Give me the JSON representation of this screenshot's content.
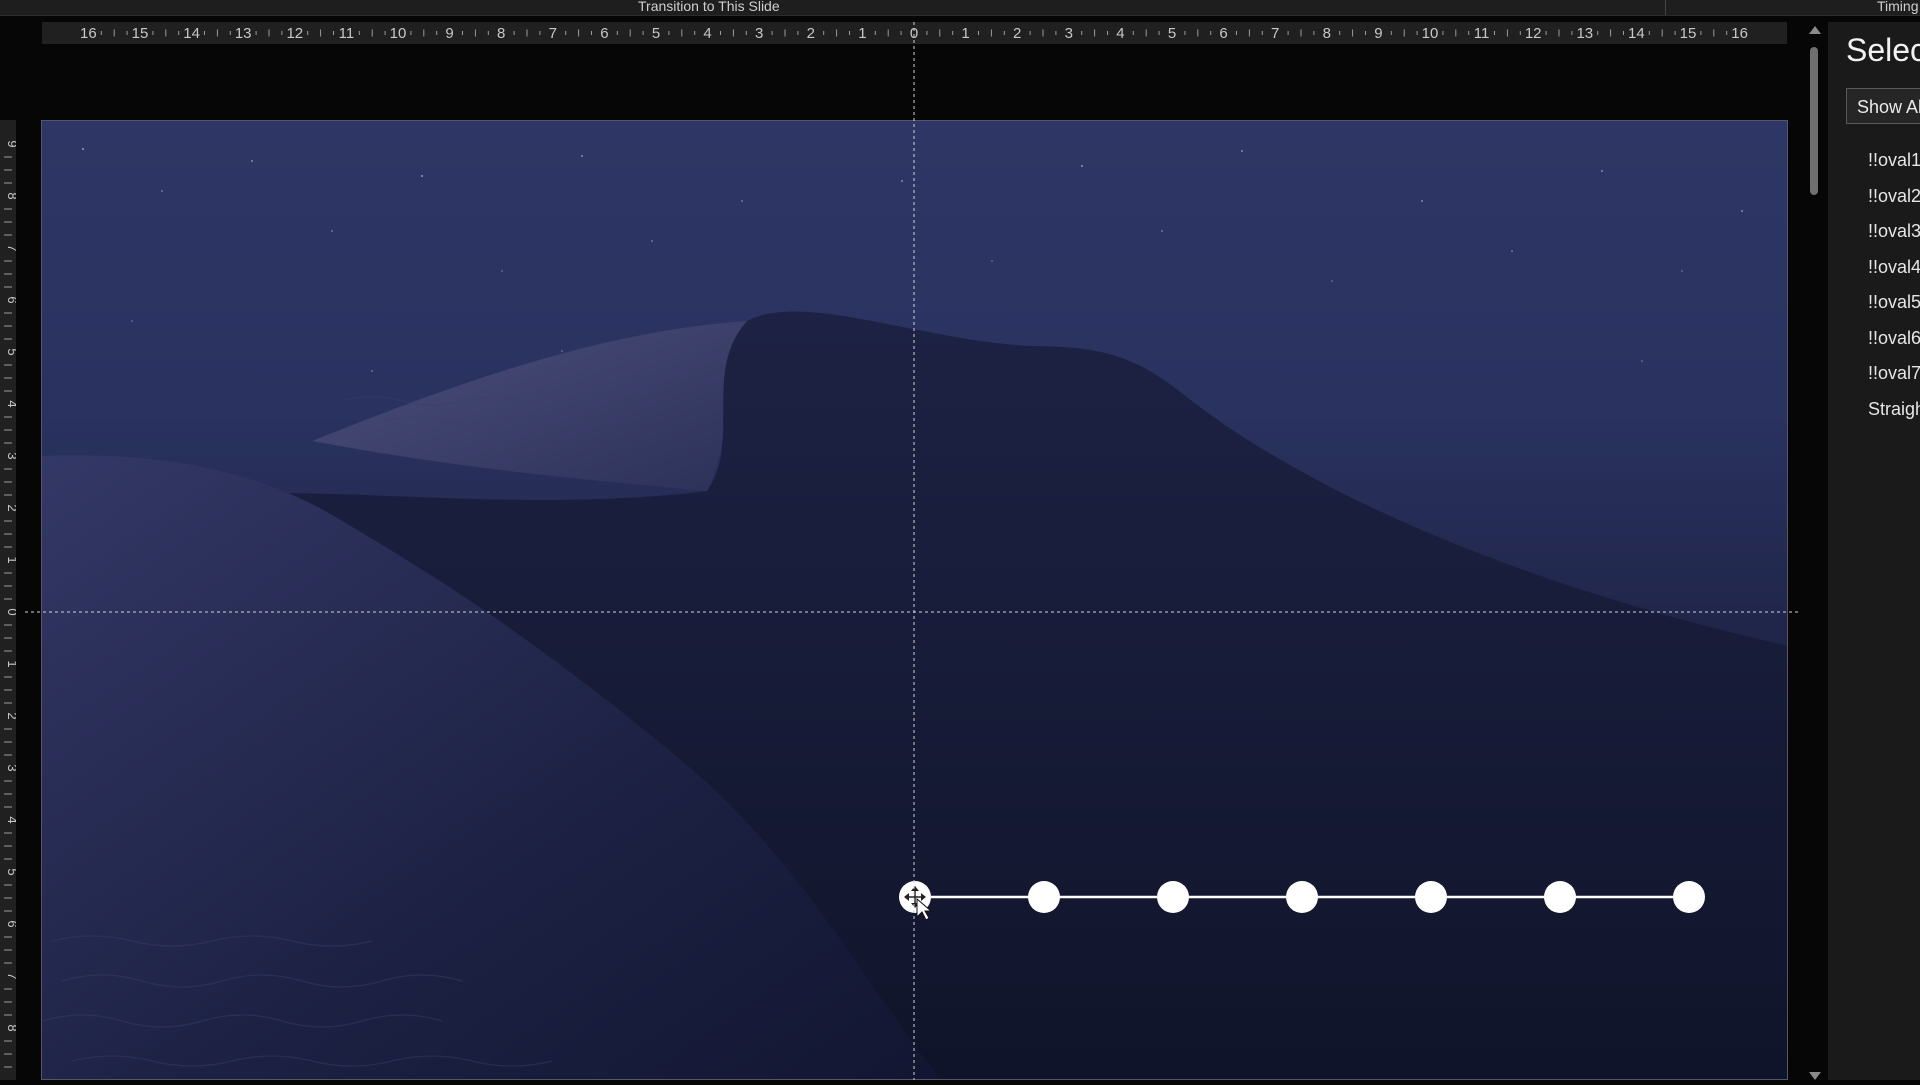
{
  "topbar": {
    "transition_label": "Transition to This Slide",
    "timing_label": "Timing"
  },
  "ruler": {
    "horizontal_ticks": [
      "16",
      "15",
      "14",
      "13",
      "12",
      "11",
      "10",
      "9",
      "8",
      "7",
      "6",
      "5",
      "4",
      "3",
      "2",
      "1",
      "0",
      "1",
      "2",
      "3",
      "4",
      "5",
      "6",
      "7",
      "8",
      "9",
      "10",
      "11",
      "12",
      "13",
      "14",
      "15",
      "16"
    ],
    "vertical_ticks": [
      "9",
      "8",
      "7",
      "6",
      "5",
      "4",
      "3",
      "2",
      "1",
      "0",
      "1",
      "2",
      "3",
      "4",
      "5",
      "6",
      "7",
      "8"
    ]
  },
  "selection_pane": {
    "title": "Selection",
    "show_all_label": "Show All",
    "items": [
      "!!oval1",
      "!!oval2",
      "!!oval3",
      "!!oval4",
      "!!oval5",
      "!!oval6",
      "!!oval7",
      "Straight Connector"
    ]
  },
  "slide": {
    "oval_count": 7
  },
  "colors": {
    "sky": "#2e3665",
    "dune_shadow": "#161b35",
    "dune_lit": "#4a4f7e",
    "oval": "#ffffff",
    "ruler_bg": "#202020",
    "pane_bg": "#1a1a1a"
  },
  "icons": {
    "cursor": "move-cursor-icon",
    "scroll_up": "triangle-up-icon",
    "scroll_down": "triangle-down-icon"
  }
}
